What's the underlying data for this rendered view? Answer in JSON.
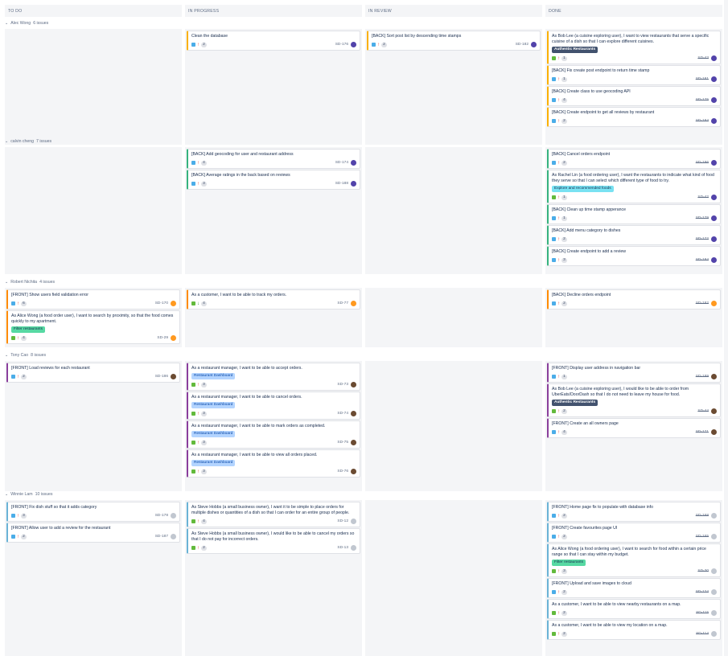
{
  "columns": [
    "TO DO",
    "IN PROGRESS",
    "IN REVIEW",
    "DONE"
  ],
  "swimlanes": [
    {
      "title": "Alec Wong",
      "count": "6 issues",
      "cells": [
        [],
        [
          {
            "summary": "Clean the database",
            "type": "task",
            "prio": "high",
            "est": "2",
            "key": "SD-176",
            "avatar": "purple",
            "color": "yellow"
          }
        ],
        [
          {
            "summary": "[BACK] Sort post list by descending time stamps",
            "type": "task",
            "prio": "high",
            "est": "2",
            "key": "SD-182",
            "avatar": "purple",
            "color": "yellow"
          }
        ],
        [
          {
            "summary": "As Bob Lee (a cuisine exploring user), I want to view restaurants that serve a specific cuisine of a dish so that I can explore different cuisines.",
            "epic": "Authentic Restaurants",
            "epicStyle": "dark",
            "type": "story",
            "prio": "high",
            "est": "1",
            "key": "SD-43",
            "avatar": "purple",
            "color": "yellow",
            "done": true,
            "long": true
          },
          {
            "summary": "[BACK] Fix create post endpoint to return time stamp",
            "type": "task",
            "prio": "high",
            "est": "1",
            "key": "SD-181",
            "avatar": "purple",
            "color": "yellow",
            "done": true
          },
          {
            "summary": "[BACK] Create class to use geocoding API",
            "type": "task",
            "prio": "high",
            "est": "4",
            "key": "SD-175",
            "avatar": "purple",
            "color": "yellow",
            "done": true
          },
          {
            "summary": "[BACK] Create endpoint to get all reviews by restaurant",
            "type": "task",
            "prio": "high",
            "est": "2",
            "key": "SD-184",
            "avatar": "purple",
            "color": "yellow",
            "done": true
          }
        ]
      ]
    },
    {
      "title": "calvin cheng",
      "count": "7 issues",
      "cells": [
        [],
        [
          {
            "summary": "[BACK] Add geocoding for user and restaurant address",
            "type": "task",
            "prio": "high",
            "est": "4",
            "key": "SD-174",
            "avatar": "purple",
            "color": "green"
          },
          {
            "summary": "[BACK] Average ratings in the back based on reviews",
            "type": "task",
            "prio": "high",
            "est": "3",
            "key": "SD-188",
            "avatar": "purple",
            "color": "green"
          }
        ],
        [],
        [
          {
            "summary": "[BACK] Cancel orders endpoint",
            "type": "task",
            "prio": "high",
            "est": "2",
            "key": "SD-186",
            "avatar": "purple",
            "color": "green",
            "done": true
          },
          {
            "summary": "As Rachel Lin (a food ordering user), I want the restaurants to indicate what kind of food they serve so that I can select which different type of food to try.",
            "epic": "Explore and recommended foods",
            "epicStyle": "teal",
            "type": "story",
            "prio": "high",
            "est": "1",
            "key": "SD-42",
            "avatar": "purple",
            "color": "green",
            "done": true,
            "long": true
          },
          {
            "summary": "[BACK] Clean up time stamp apperance",
            "type": "task",
            "prio": "high",
            "est": "1",
            "key": "SD-179",
            "avatar": "purple",
            "color": "green",
            "done": true
          },
          {
            "summary": "[BACK] Add menu category to dishes",
            "type": "task",
            "prio": "high",
            "est": "2",
            "key": "SD-172",
            "avatar": "purple",
            "color": "green",
            "done": true
          },
          {
            "summary": "[BACK] Create endpoint to add a review",
            "type": "task",
            "prio": "high",
            "est": "3",
            "key": "SD-184",
            "avatar": "purple",
            "color": "green",
            "done": true
          }
        ]
      ]
    },
    {
      "title": "Robert Nichita",
      "count": "4 issues",
      "cells": [
        [
          {
            "summary": "[FRONT] Show users field validation error",
            "type": "task",
            "prio": "high",
            "est": "6",
            "key": "SD-170",
            "avatar": "orange",
            "color": "orange"
          },
          {
            "summary": "As Alice Wong (a food order user), I want to search by proximity, so that the food comes quickly to my apartment.",
            "epic": "Filter restaurants",
            "epicStyle": "green",
            "type": "story",
            "prio": "high",
            "est": "4",
            "key": "SD-29",
            "avatar": "orange",
            "color": "orange",
            "long": true
          }
        ],
        [
          {
            "summary": "As a customer, I want to be able to track my orders.",
            "type": "story",
            "prio": "low",
            "est": "4",
            "key": "SD-77",
            "avatar": "orange",
            "color": "orange"
          }
        ],
        [],
        [
          {
            "summary": "[BACK] Decline orders endpoint",
            "type": "task",
            "prio": "high",
            "est": "2",
            "key": "SD-182",
            "avatar": "orange",
            "color": "orange",
            "done": true
          }
        ]
      ]
    },
    {
      "title": "Tony Cao",
      "count": "8 issues",
      "cells": [
        [
          {
            "summary": "[FRONT] Load reviews for each restaurant",
            "type": "task",
            "prio": "high",
            "est": "2",
            "key": "SD-186",
            "avatar": "brown",
            "color": "purple"
          }
        ],
        [
          {
            "summary": "As a restaurant manager, I want to be able to accept orders.",
            "epic": "Restaurant Dashboard",
            "epicStyle": "blue",
            "type": "story",
            "prio": "high",
            "est": "3",
            "key": "SD-73",
            "avatar": "brown",
            "color": "purple"
          },
          {
            "summary": "As a restaurant manager, I want to be able to cancel orders.",
            "epic": "Restaurant Dashboard",
            "epicStyle": "blue",
            "type": "story",
            "prio": "high",
            "est": "3",
            "key": "SD-74",
            "avatar": "brown",
            "color": "purple"
          },
          {
            "summary": "As a restaurant manager, I want to be able to mark orders as completed.",
            "epic": "Restaurant Dashboard",
            "epicStyle": "blue",
            "type": "story",
            "prio": "high",
            "est": "3",
            "key": "SD-75",
            "avatar": "brown",
            "color": "purple"
          },
          {
            "summary": "As a restaurant manager, I want to be able to view all orders placed.",
            "epic": "Restaurant Dashboard",
            "epicStyle": "blue",
            "type": "story",
            "prio": "high",
            "est": "3",
            "key": "SD-76",
            "avatar": "brown",
            "color": "purple"
          }
        ],
        [],
        [
          {
            "summary": "[FRONT] Display user address in navigation bar",
            "type": "task",
            "prio": "high",
            "est": "1",
            "key": "SD-189",
            "avatar": "brown",
            "color": "purple",
            "done": true
          },
          {
            "summary": "As Bob Lee (a cuisine exploring user), I would like to be able to order from UberEats/DoorDash so that I do not need to leave my house for food.",
            "epic": "Authentic Restaurants",
            "epicStyle": "dark",
            "type": "story",
            "prio": "high",
            "est": "2",
            "key": "SD-44",
            "avatar": "brown",
            "color": "purple",
            "done": true,
            "long": true
          },
          {
            "summary": "[FRONT] Create an all owners page",
            "type": "task",
            "prio": "high",
            "est": "4",
            "key": "SD-171",
            "avatar": "brown",
            "color": "purple",
            "done": true
          }
        ]
      ]
    },
    {
      "title": "Winnie Lam",
      "count": "10 issues",
      "cells": [
        [
          {
            "summary": "[FRONT] Fix dish stuff so that it adds category",
            "type": "task",
            "prio": "high",
            "est": "3",
            "key": "SD-178",
            "avatar": "grey",
            "color": "blue"
          },
          {
            "summary": "[FRONT] Allow user to add a review for the restaurant",
            "type": "task",
            "prio": "high",
            "est": "2",
            "key": "SD-187",
            "avatar": "grey",
            "color": "blue"
          }
        ],
        [
          {
            "summary": "As Steve Hobbs (a small business owner), I want it to be simple to place orders for multiple dishes or quantities of a dish so that I can order for an entire group of people.",
            "type": "story",
            "prio": "high",
            "est": "4",
            "key": "SD-12",
            "avatar": "grey",
            "color": "blue",
            "long": true
          },
          {
            "summary": "As Steve Hobbs (a small business owner), I would like to be able to cancel my orders so that I do not pay for incorrect orders.",
            "type": "story",
            "prio": "high",
            "est": "2",
            "key": "SD-13",
            "avatar": "grey",
            "color": "blue"
          }
        ],
        [],
        [
          {
            "summary": "[FRONT] Home page fix to populate with database info",
            "type": "task",
            "prio": "high",
            "est": "2",
            "key": "SD-168",
            "avatar": "grey",
            "color": "blue",
            "done": true
          },
          {
            "summary": "[FRONT] Create favourites page UI",
            "type": "task",
            "prio": "high",
            "est": "2",
            "key": "SD-165",
            "avatar": "grey",
            "color": "blue",
            "done": true
          },
          {
            "summary": "As Alice Wong (a food ordering user), I want to search for food within a certain price range so that I can stay within my budget.",
            "epic": "Filter restaurants",
            "epicStyle": "green",
            "type": "story",
            "prio": "high",
            "est": "3",
            "key": "SD-30",
            "avatar": "grey",
            "color": "blue",
            "done": true,
            "long": true
          },
          {
            "summary": "[FRONT] Upload and save images to cloud",
            "type": "task",
            "prio": "high",
            "est": "2",
            "key": "SD-124",
            "avatar": "grey",
            "color": "blue",
            "done": true
          },
          {
            "summary": "As a customer, I want to be able to view nearby restaurants on a map.",
            "type": "story",
            "prio": "high",
            "est": "2",
            "key": "SD-115",
            "avatar": "grey",
            "color": "blue",
            "done": true
          },
          {
            "summary": "As a customer, I want to be able to view my location on a map.",
            "type": "story",
            "prio": "high",
            "est": "2",
            "key": "SD-114",
            "avatar": "grey",
            "color": "blue",
            "done": true
          }
        ]
      ]
    }
  ]
}
